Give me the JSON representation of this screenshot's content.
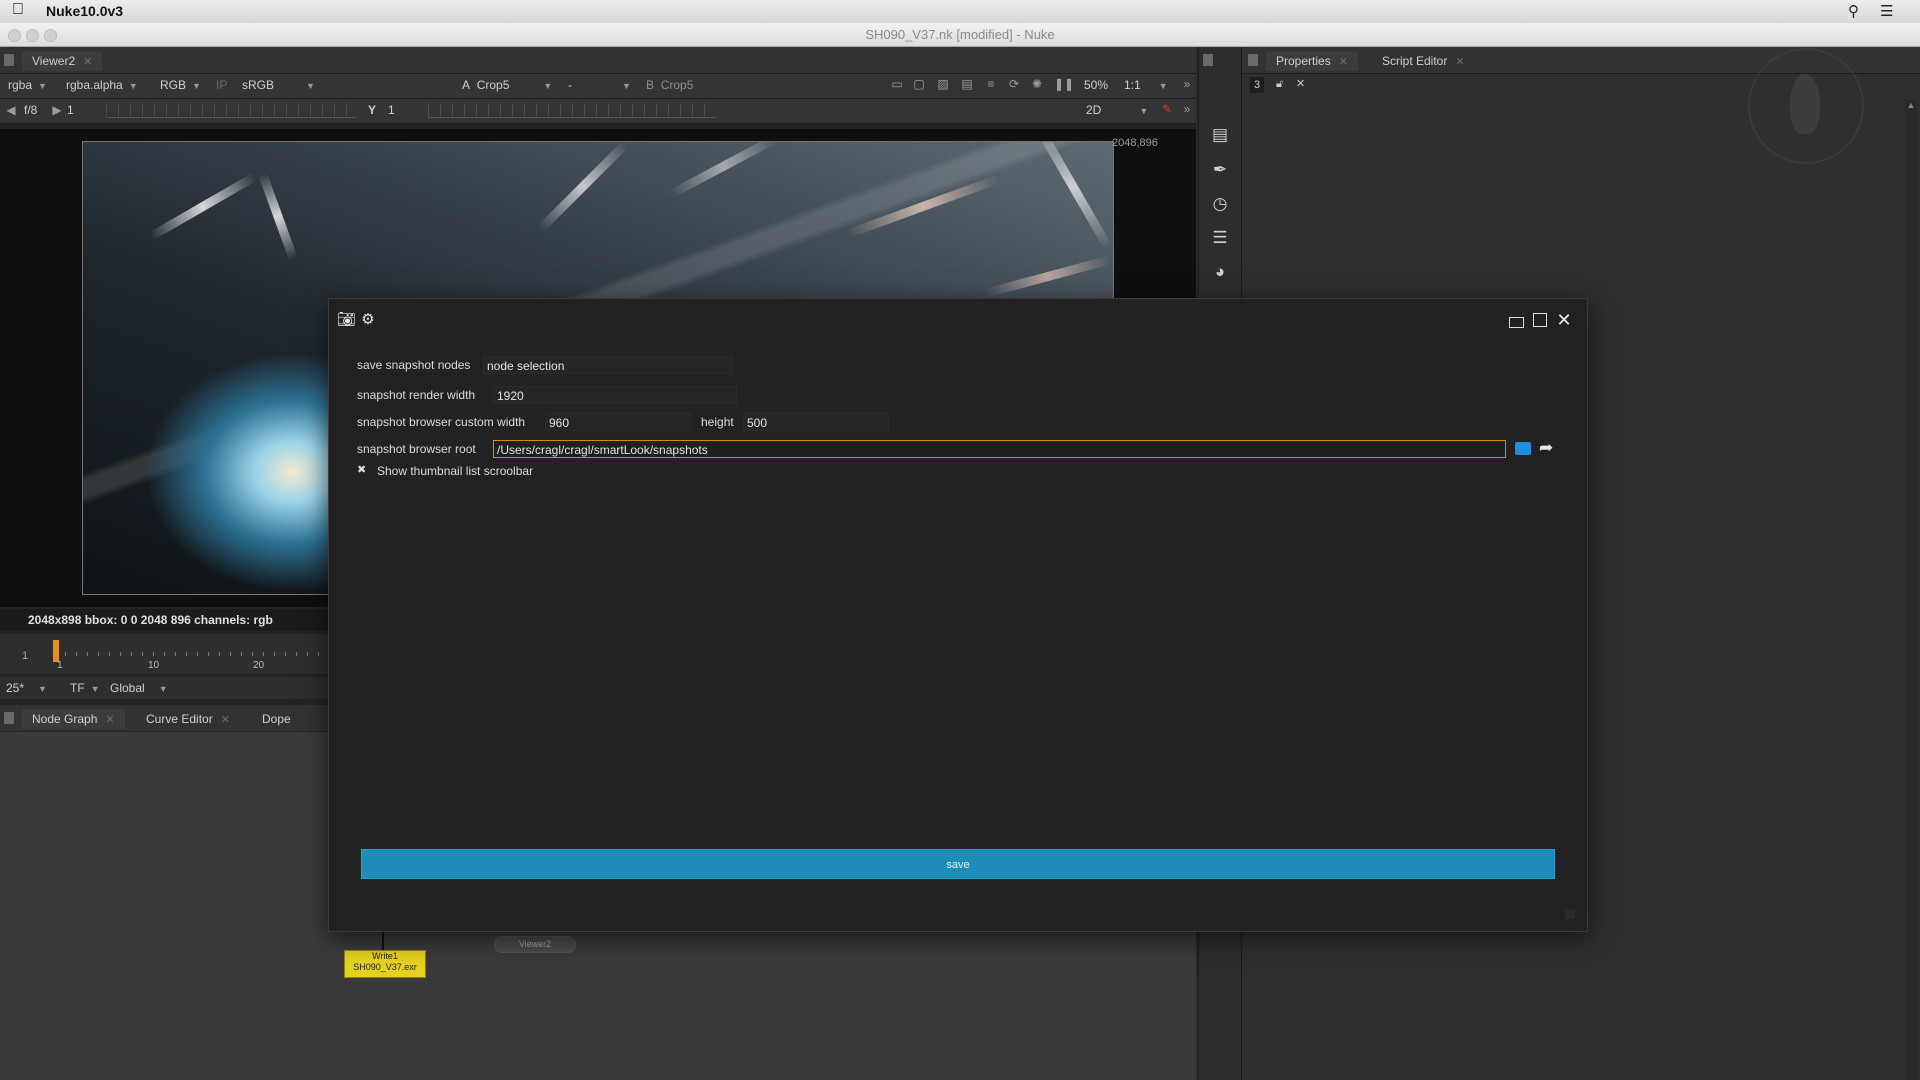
{
  "menubar": {
    "apple_icon": "apple-icon",
    "app_name": "Nuke10.0v3",
    "search_icon": "search-icon",
    "list_icon": "list-icon"
  },
  "window": {
    "title": "SH090_V37.nk [modified] - Nuke"
  },
  "viewer": {
    "tab_label": "Viewer2",
    "toolbar": {
      "channels": "rgba",
      "alpha": "rgba.alpha",
      "colorspace_rgb": "RGB",
      "ip": "IP",
      "lut": "sRGB",
      "a_label": "A",
      "a_input": "Crop5",
      "dash": "-",
      "b_label": "B",
      "b_input": "Crop5",
      "zoom": "50%",
      "ratio": "1:1"
    },
    "frame_row": {
      "fstop": "f/8",
      "gain": "1",
      "y_label": "Y",
      "gamma": "1",
      "mode": "2D"
    },
    "coord_label": "2048,896",
    "info_text": "2048x898  bbox: 0 0 2048 896 channels: rgb",
    "timeline": {
      "current": "1",
      "ticks": [
        "1",
        "10",
        "20"
      ],
      "fps": "25*",
      "tf": "TF",
      "global": "Global"
    }
  },
  "bottom_tabs": {
    "node_graph": "Node Graph",
    "curve_editor": "Curve Editor",
    "dope_sheet": "Dope Sheet"
  },
  "nodes": {
    "write_name": "Write1",
    "write_file": "SH090_V37.exr",
    "viewer_node": "Viewer2"
  },
  "right_panel": {
    "properties_tab": "Properties",
    "script_editor_tab": "Script Editor",
    "count": "3"
  },
  "dialog": {
    "snapshot_nodes_label": "save snapshot nodes",
    "snapshot_nodes_value": "node selection",
    "render_width_label": "snapshot render width",
    "render_width_value": "1920",
    "custom_width_label": "snapshot browser custom width",
    "custom_width_value": "960",
    "height_label": "height",
    "height_value": "500",
    "root_label": "snapshot browser root",
    "root_value": "/Users/cragl/cragl/smartLook/snapshots",
    "checkbox_label": "Show thumbnail list scroolbar",
    "checkbox_checked": true,
    "save_label": "save"
  },
  "colors": {
    "accent_blue": "#1e8cb8",
    "focus_orange": "#d68a18",
    "node_yellow": "#e6d21f"
  }
}
